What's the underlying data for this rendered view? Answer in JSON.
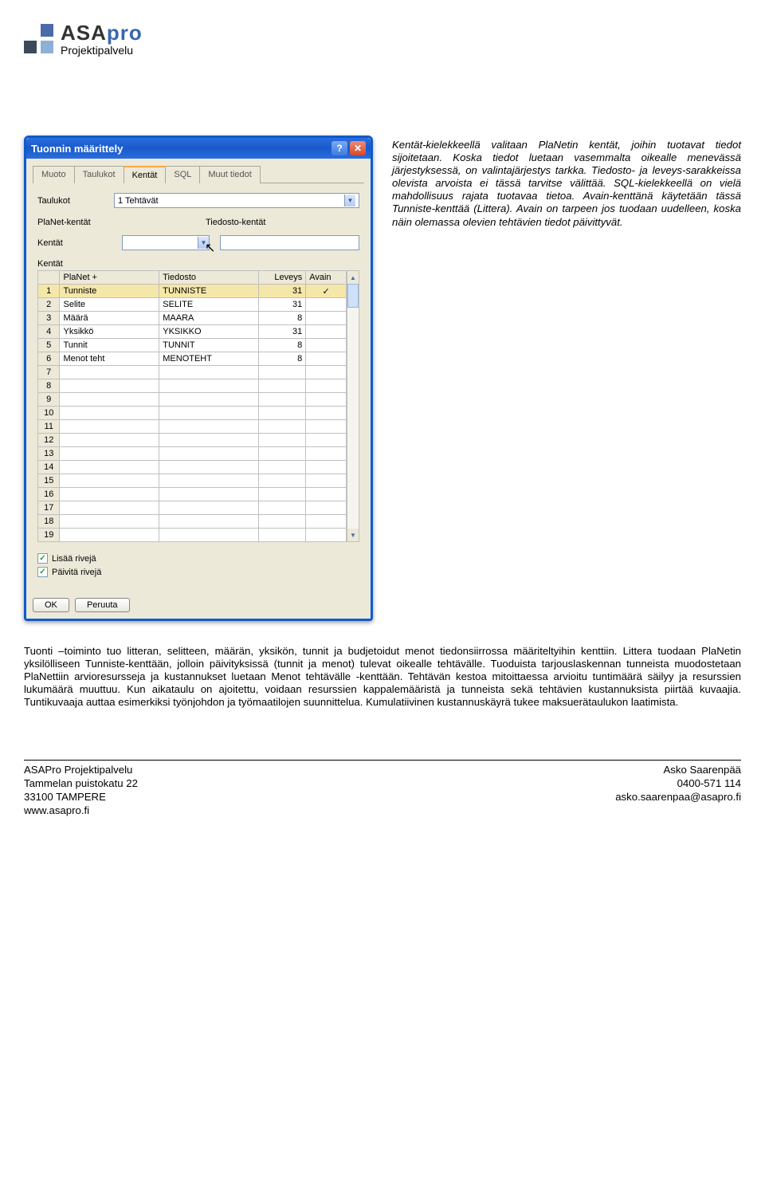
{
  "logo": {
    "asa": "ASA",
    "pro": "pro",
    "sub": "Projektipalvelu"
  },
  "dialog": {
    "title": "Tuonnin määrittely",
    "tabs": [
      "Muoto",
      "Taulukot",
      "Kentät",
      "SQL",
      "Muut tiedot"
    ],
    "activeTab": 2,
    "labels": {
      "taulukot": "Taulukot",
      "taulukot_val": "1 Tehtävät",
      "planet": "PlaNet-kentät",
      "tiedosto": "Tiedosto-kentät",
      "kentat": "Kentät",
      "section": "Kentät",
      "th_planet": "PlaNet +",
      "th_tiedosto": "Tiedosto",
      "th_leveys": "Leveys",
      "th_avain": "Avain",
      "lisaa": "Lisää rivejä",
      "paivita": "Päivitä rivejä",
      "ok": "OK",
      "cancel": "Peruuta"
    },
    "rows": [
      {
        "n": "1",
        "p": "Tunniste",
        "t": "TUNNISTE",
        "w": "31",
        "a": "✓",
        "hl": true
      },
      {
        "n": "2",
        "p": "Selite",
        "t": "SELITE",
        "w": "31",
        "a": ""
      },
      {
        "n": "3",
        "p": "Määrä",
        "t": "MAARA",
        "w": "8",
        "a": ""
      },
      {
        "n": "4",
        "p": "Yksikkö",
        "t": "YKSIKKO",
        "w": "31",
        "a": ""
      },
      {
        "n": "5",
        "p": "Tunnit",
        "t": "TUNNIT",
        "w": "8",
        "a": ""
      },
      {
        "n": "6",
        "p": "Menot teht",
        "t": "MENOTEHT",
        "w": "8",
        "a": ""
      },
      {
        "n": "7",
        "p": "",
        "t": "",
        "w": "",
        "a": ""
      },
      {
        "n": "8",
        "p": "",
        "t": "",
        "w": "",
        "a": ""
      },
      {
        "n": "9",
        "p": "",
        "t": "",
        "w": "",
        "a": ""
      },
      {
        "n": "10",
        "p": "",
        "t": "",
        "w": "",
        "a": ""
      },
      {
        "n": "11",
        "p": "",
        "t": "",
        "w": "",
        "a": ""
      },
      {
        "n": "12",
        "p": "",
        "t": "",
        "w": "",
        "a": ""
      },
      {
        "n": "13",
        "p": "",
        "t": "",
        "w": "",
        "a": ""
      },
      {
        "n": "14",
        "p": "",
        "t": "",
        "w": "",
        "a": ""
      },
      {
        "n": "15",
        "p": "",
        "t": "",
        "w": "",
        "a": ""
      },
      {
        "n": "16",
        "p": "",
        "t": "",
        "w": "",
        "a": ""
      },
      {
        "n": "17",
        "p": "",
        "t": "",
        "w": "",
        "a": ""
      },
      {
        "n": "18",
        "p": "",
        "t": "",
        "w": "",
        "a": ""
      },
      {
        "n": "19",
        "p": "",
        "t": "",
        "w": "",
        "a": ""
      }
    ]
  },
  "side": "Kentät-kielekkeellä valitaan PlaNetin kentät, joihin tuotavat tiedot sijoitetaan. Koska tiedot luetaan vasemmalta oikealle menevässä järjestyksessä, on valintajärjestys tarkka. Tiedosto- ja leveys-sarakkeissa olevista arvoista ei tässä tarvitse välittää. SQL-kielekkeellä on vielä mahdollisuus rajata tuotavaa tietoa. Avain-kenttänä käytetään tässä Tunniste-kenttää (Littera). Avain on tarpeen jos tuodaan uudelleen, koska näin olemassa olevien tehtävien tiedot päivittyvät.",
  "body": "Tuonti –toiminto tuo litteran, selitteen, määrän, yksikön, tunnit ja budjetoidut menot tiedonsiirrossa määriteltyihin kenttiin. Littera tuodaan PlaNetin yksilölliseen Tunniste-kenttään, jolloin päivityksissä (tunnit ja menot) tulevat oikealle tehtävälle. Tuoduista tarjouslaskennan tunneista muodostetaan PlaNettiin arvioresursseja ja kustannukset luetaan Menot tehtävälle -kenttään. Tehtävän kestoa mitoittaessa arvioitu tuntimäärä säilyy ja resurssien lukumäärä muuttuu. Kun aikataulu on ajoitettu, voidaan resurssien kappalemääristä ja tunneista sekä tehtävien kustannuksista piirtää kuvaajia. Tuntikuvaaja auttaa esimerkiksi työnjohdon ja  työmaatilojen suunnittelua. Kumulatiivinen kustannuskäyrä tukee maksuerätaulukon laatimista.",
  "footer": {
    "l1": "ASAPro Projektipalvelu",
    "l2": "Tammelan puistokatu 22",
    "l3": "33100 TAMPERE",
    "l4": "www.asapro.fi",
    "r1": "Asko Saarenpää",
    "r2": "0400-571 114",
    "r3": "asko.saarenpaa@asapro.fi"
  }
}
